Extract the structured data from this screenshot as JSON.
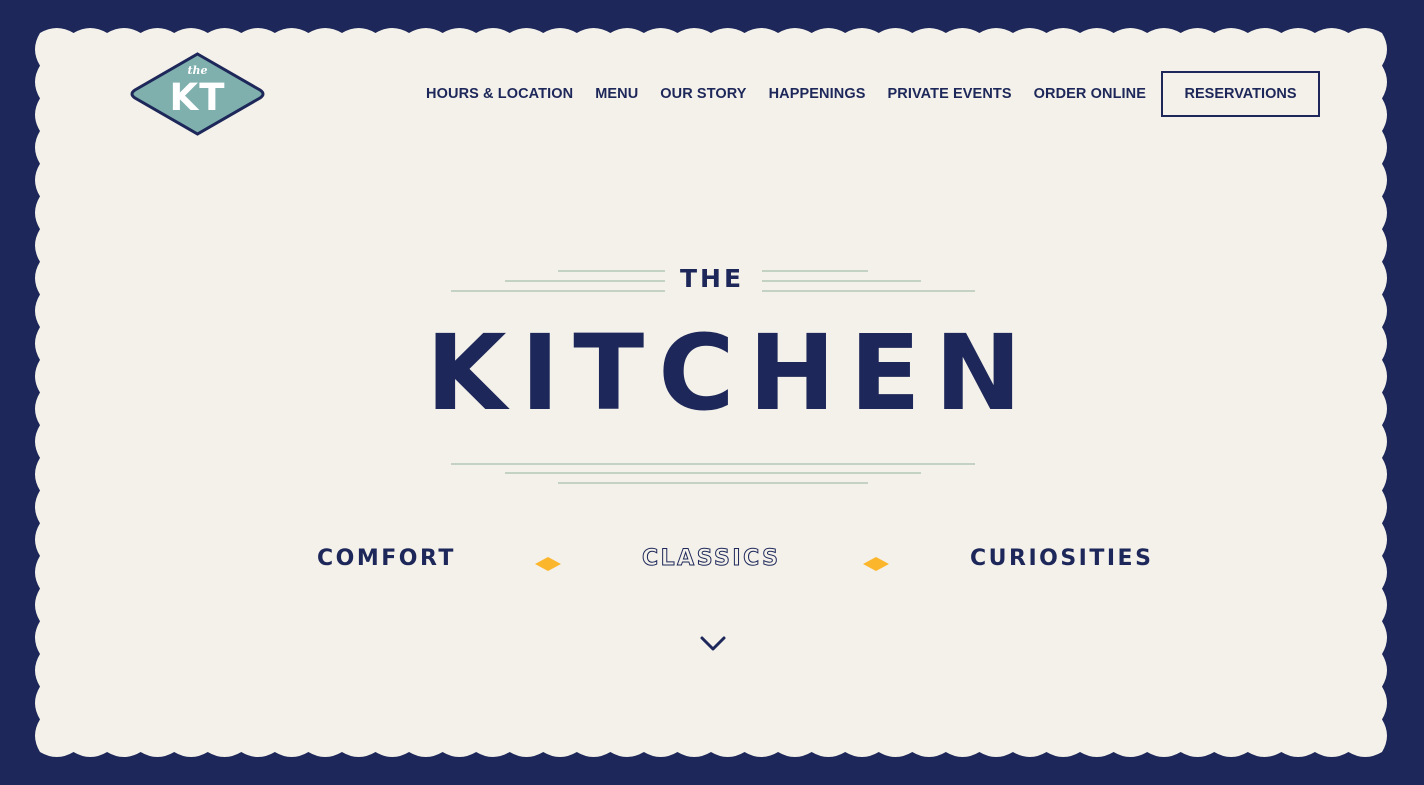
{
  "logo": {
    "small_text": "the",
    "large_text": "KT",
    "color": "#7fb0ae"
  },
  "nav": {
    "items": [
      {
        "label": "HOURS & LOCATION"
      },
      {
        "label": "MENU"
      },
      {
        "label": "OUR STORY"
      },
      {
        "label": "HAPPENINGS"
      },
      {
        "label": "PRIVATE EVENTS"
      },
      {
        "label": "ORDER ONLINE"
      }
    ],
    "reservations_label": "RESERVATIONS"
  },
  "hero": {
    "pre_title": "THE",
    "title": "KITCHEN",
    "tagline": [
      "COMFORT",
      "CLASSICS",
      "CURIOSITIES"
    ],
    "scroll_icon": "chevron-down-icon"
  },
  "colors": {
    "navy": "#1d2759",
    "cream": "#f3f1ea",
    "accent_yellow": "#fbb62b",
    "line_sage": "#b5c7b8",
    "logo_teal": "#7fb0ae"
  }
}
